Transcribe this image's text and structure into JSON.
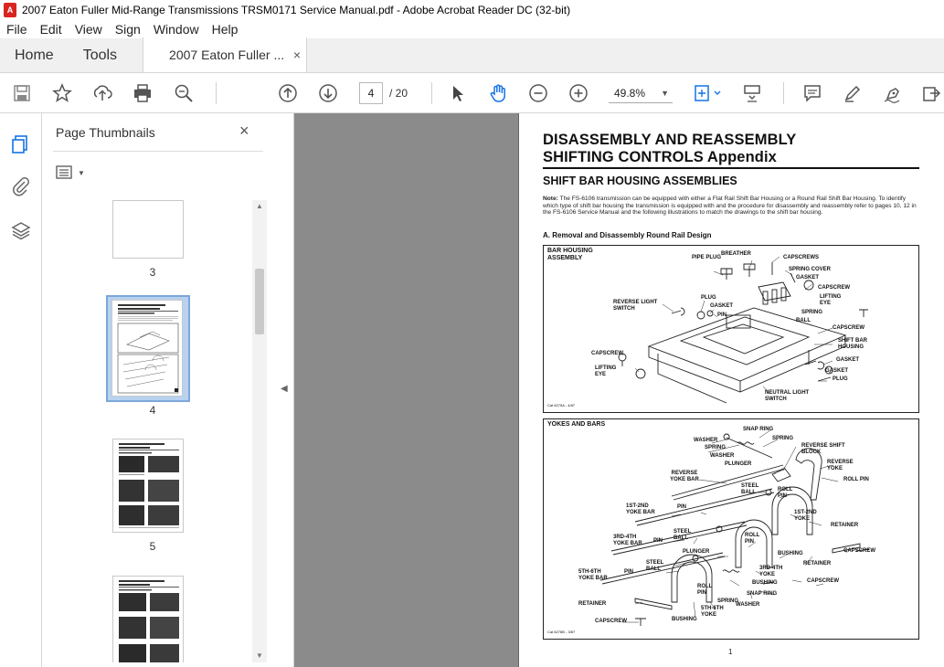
{
  "window": {
    "title": "2007 Eaton Fuller Mid-Range Transmissions TRSM0171 Service Manual.pdf - Adobe Acrobat Reader DC (32-bit)"
  },
  "menu": [
    "File",
    "Edit",
    "View",
    "Sign",
    "Window",
    "Help"
  ],
  "tabs": {
    "home": "Home",
    "tools": "Tools",
    "document": "2007 Eaton Fuller ...",
    "close": "×"
  },
  "toolbar": {
    "page_current": "4",
    "page_total": "/ 20",
    "zoom": "49.8%",
    "icons": [
      "save-icon",
      "star-icon",
      "upload-icon",
      "print-icon",
      "search-zoom-icon",
      "arrow-up-icon",
      "arrow-down-icon",
      "pointer-icon",
      "hand-icon",
      "zoom-out-icon",
      "zoom-in-icon",
      "fit-page-icon",
      "scroll-mode-icon",
      "comment-icon",
      "highlight-icon",
      "sign-icon",
      "share-icon"
    ]
  },
  "sidebar": {
    "title": "Page Thumbnails",
    "close": "×",
    "thumbnails": [
      {
        "label": "3"
      },
      {
        "label": "4",
        "selected": true
      },
      {
        "label": "5"
      },
      {
        "label": ""
      }
    ]
  },
  "document": {
    "heading_line1": "DISASSEMBLY AND REASSEMBLY",
    "heading_line2": "SHIFTING CONTROLS Appendix",
    "section_title": "SHIFT BAR HOUSING ASSEMBLIES",
    "note_label": "Note:",
    "note_text": "The FS-6106 transmission can be equipped with either a Flat Rail Shift Bar Housing or a Round Rail Shift Bar Housing. To identify which type of shift bar housing the transmission is equipped with and the procedure for disassembly and reassembly refer to pages 10, 12 in the FS-6106 Service Manual and the following illustrations to match the drawings to the shift bar housing.",
    "subsection": "A. Removal and Disassembly Round Rail Design",
    "page_number": "1",
    "figure1": {
      "label": "BAR HOUSING ASSEMBLY",
      "caption": "Cat 6275A - 4/87",
      "callouts": [
        "PIPE PLUG",
        "BREATHER",
        "CAPSCREWS",
        "SPRING COVER",
        "GASKET",
        "CAPSCREW",
        "LIFTING EYE",
        "REVERSE LIGHT SWITCH",
        "PLUG",
        "GASKET",
        "PIN",
        "SPRING",
        "BALL",
        "CAPSCREW",
        "SHIFT BAR HOUSING",
        "CAPSCREW",
        "LIFTING EYE",
        "GASKET",
        "GASKET",
        "PLUG",
        "NEUTRAL LIGHT SWITCH"
      ]
    },
    "figure2": {
      "label": "YOKES AND BARS",
      "caption": "Cat 6276B - 3/87",
      "callouts": [
        "SNAP RING",
        "WASHER",
        "SPRING",
        "SPRING",
        "WASHER",
        "REVERSE SHIFT BLOCK",
        "PLUNGER",
        "REVERSE YOKE",
        "REVERSE YOKE BAR",
        "ROLL PIN",
        "STEEL BALL",
        "ROLL PIN",
        "1ST-2ND YOKE BAR",
        "PIN",
        "1ST-2ND YOKE",
        "RETAINER",
        "3RD-4TH YOKE BAR",
        "PIN",
        "STEEL BALL",
        "ROLL PIN",
        "CAPSCREW",
        "PLUNGER",
        "BUSHING",
        "RETAINER",
        "STEEL BALL",
        "5TH-6TH YOKE BAR",
        "PIN",
        "3RD-4TH YOKE",
        "ROLL PIN",
        "BUSHING",
        "CAPSCREW",
        "SNAP RING",
        "SPRING",
        "WASHER",
        "RETAINER",
        "5TH-6TH YOKE",
        "CAPSCREW",
        "BUSHING"
      ]
    }
  }
}
